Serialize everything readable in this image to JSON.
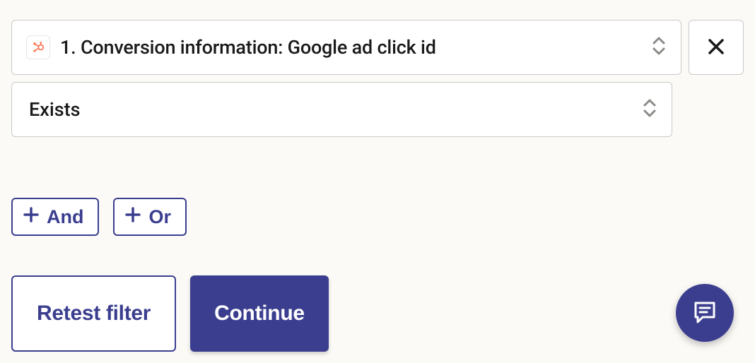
{
  "filter": {
    "field_label": "1. Conversion information: Google ad click id",
    "condition_label": "Exists"
  },
  "logic": {
    "and_label": "And",
    "or_label": "Or"
  },
  "actions": {
    "retest_label": "Retest filter",
    "continue_label": "Continue"
  },
  "icons": {
    "hubspot": "hubspot-icon",
    "sort": "sort-icon",
    "close": "close-icon",
    "plus": "plus-icon",
    "chat": "chat-icon"
  }
}
